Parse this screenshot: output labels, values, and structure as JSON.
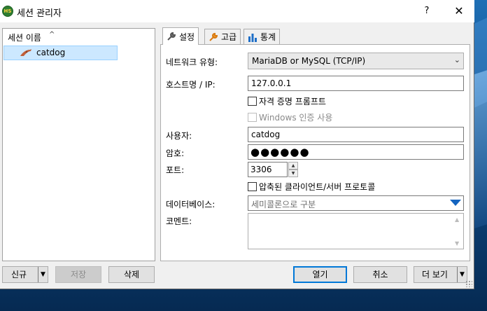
{
  "window": {
    "app_icon_text": "HS",
    "title": "세션 관리자",
    "help_label": "?",
    "close_label": "✕"
  },
  "session_tree": {
    "header": "세션 이름",
    "sort_indicator": "^",
    "items": [
      {
        "label": "catdog",
        "icon": "dolphin-icon",
        "selected": true
      }
    ]
  },
  "tabs": [
    {
      "label": "설정",
      "icon": "wrench-icon",
      "active": true
    },
    {
      "label": "고급",
      "icon": "wrench-orange-icon",
      "active": false
    },
    {
      "label": "통계",
      "icon": "bar-chart-icon",
      "active": false
    }
  ],
  "settings": {
    "network_type_label": "네트워크 유형:",
    "network_type_value": "MariaDB or MySQL (TCP/IP)",
    "host_label": "호스트명 / IP:",
    "host_value": "127.0.0.1",
    "prompt_credentials_label": "자격 증명 프롬프트",
    "prompt_credentials_checked": false,
    "windows_auth_label": "Windows 인증 사용",
    "windows_auth_checked": false,
    "user_label": "사용자:",
    "user_value": "catdog",
    "password_label": "암호:",
    "password_value": "●●●●●●",
    "port_label": "포트:",
    "port_value": "3306",
    "compressed_label": "압축된 클라이언트/서버 프로토콜",
    "compressed_checked": false,
    "database_label": "데이터베이스:",
    "database_placeholder": "세미콜론으로 구분",
    "comment_label": "코멘트:",
    "comment_value": ""
  },
  "buttons": {
    "new": "신규",
    "save": "저장",
    "delete": "삭제",
    "open": "열기",
    "cancel": "취소",
    "more": "더 보기"
  },
  "colors": {
    "accent": "#0078d7",
    "selection": "#cce8ff",
    "dropdown_arrow": "#1565c0"
  }
}
